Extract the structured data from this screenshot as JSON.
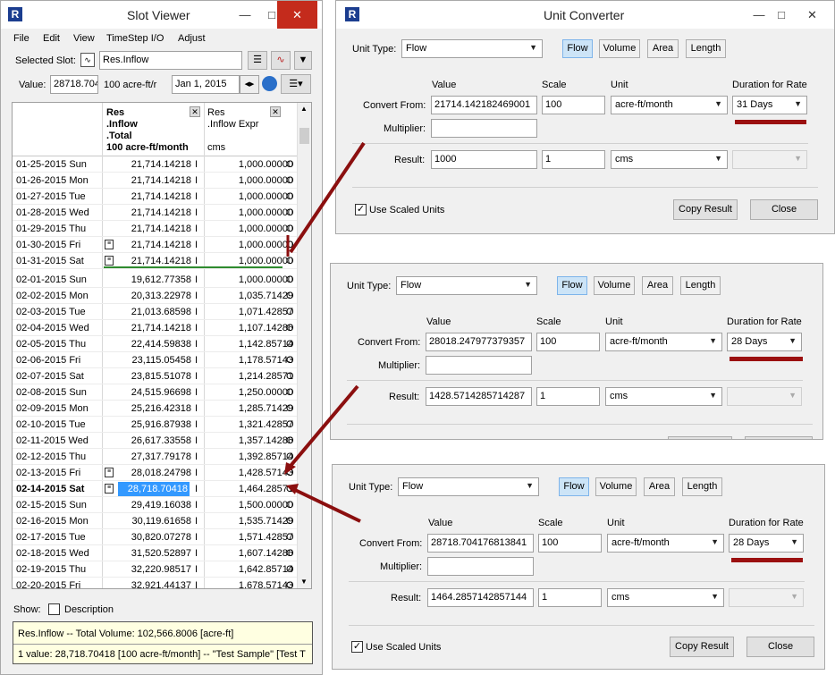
{
  "slot_viewer": {
    "title": "Slot Viewer",
    "menu": [
      "File",
      "Edit",
      "View",
      "TimeStep I/O",
      "Adjust"
    ],
    "selected_slot_label": "Selected Slot:",
    "selected_slot_value": "Res.Inflow",
    "value_label": "Value:",
    "value_field": "28718.704",
    "value_units": "100 acre-ft/r",
    "date_field": "Jan 1, 2015",
    "col1_header": [
      ".Inflow",
      ".Total",
      "100 acre-ft/month"
    ],
    "col1_header_top": "Res",
    "col2_header_top": "Res",
    "col2_header": ".Inflow Expr",
    "col2_units": "cms",
    "rows": [
      {
        "date": "01-25-2015 Sun",
        "v1": "21,714.14218",
        "f1": "I",
        "v2": "1,000.00000",
        "f2": "O",
        "note": false
      },
      {
        "date": "01-26-2015 Mon",
        "v1": "21,714.14218",
        "f1": "I",
        "v2": "1,000.00000",
        "f2": "O",
        "note": false
      },
      {
        "date": "01-27-2015 Tue",
        "v1": "21,714.14218",
        "f1": "I",
        "v2": "1,000.00000",
        "f2": "O",
        "note": false
      },
      {
        "date": "01-28-2015 Wed",
        "v1": "21,714.14218",
        "f1": "I",
        "v2": "1,000.00000",
        "f2": "O",
        "note": false
      },
      {
        "date": "01-29-2015 Thu",
        "v1": "21,714.14218",
        "f1": "I",
        "v2": "1,000.00000",
        "f2": "O",
        "note": false
      },
      {
        "date": "01-30-2015 Fri",
        "v1": "21,714.14218",
        "f1": "I",
        "v2": "1,000.00000",
        "f2": "O",
        "note": true
      },
      {
        "date": "01-31-2015 Sat",
        "v1": "21,714.14218",
        "f1": "I",
        "v2": "1,000.00000",
        "f2": "O",
        "note": true
      },
      {
        "date": "02-01-2015 Sun",
        "v1": "19,612.77358",
        "f1": "I",
        "v2": "1,000.00000",
        "f2": "O",
        "note": false
      },
      {
        "date": "02-02-2015 Mon",
        "v1": "20,313.22978",
        "f1": "I",
        "v2": "1,035.71429",
        "f2": "O",
        "note": false
      },
      {
        "date": "02-03-2015 Tue",
        "v1": "21,013.68598",
        "f1": "I",
        "v2": "1,071.42857",
        "f2": "O",
        "note": false
      },
      {
        "date": "02-04-2015 Wed",
        "v1": "21,714.14218",
        "f1": "I",
        "v2": "1,107.14286",
        "f2": "O",
        "note": false
      },
      {
        "date": "02-05-2015 Thu",
        "v1": "22,414.59838",
        "f1": "I",
        "v2": "1,142.85714",
        "f2": "O",
        "note": false
      },
      {
        "date": "02-06-2015 Fri",
        "v1": "23,115.05458",
        "f1": "I",
        "v2": "1,178.57143",
        "f2": "O",
        "note": false
      },
      {
        "date": "02-07-2015 Sat",
        "v1": "23,815.51078",
        "f1": "I",
        "v2": "1,214.28571",
        "f2": "O",
        "note": false
      },
      {
        "date": "02-08-2015 Sun",
        "v1": "24,515.96698",
        "f1": "I",
        "v2": "1,250.00000",
        "f2": "O",
        "note": false
      },
      {
        "date": "02-09-2015 Mon",
        "v1": "25,216.42318",
        "f1": "I",
        "v2": "1,285.71429",
        "f2": "O",
        "note": false
      },
      {
        "date": "02-10-2015 Tue",
        "v1": "25,916.87938",
        "f1": "I",
        "v2": "1,321.42857",
        "f2": "O",
        "note": false
      },
      {
        "date": "02-11-2015 Wed",
        "v1": "26,617.33558",
        "f1": "I",
        "v2": "1,357.14286",
        "f2": "O",
        "note": false
      },
      {
        "date": "02-12-2015 Thu",
        "v1": "27,317.79178",
        "f1": "I",
        "v2": "1,392.85714",
        "f2": "O",
        "note": false
      },
      {
        "date": "02-13-2015 Fri",
        "v1": "28,018.24798",
        "f1": "I",
        "v2": "1,428.57143",
        "f2": "O",
        "note": true
      },
      {
        "date": "02-14-2015 Sat",
        "v1": "28,718.70418",
        "f1": "I",
        "v2": "1,464.28571",
        "f2": "O",
        "note": true,
        "selected": true
      },
      {
        "date": "02-15-2015 Sun",
        "v1": "29,419.16038",
        "f1": "I",
        "v2": "1,500.00000",
        "f2": "O",
        "note": false
      },
      {
        "date": "02-16-2015 Mon",
        "v1": "30,119.61658",
        "f1": "I",
        "v2": "1,535.71429",
        "f2": "O",
        "note": false
      },
      {
        "date": "02-17-2015 Tue",
        "v1": "30,820.07278",
        "f1": "I",
        "v2": "1,571.42857",
        "f2": "O",
        "note": false
      },
      {
        "date": "02-18-2015 Wed",
        "v1": "31,520.52897",
        "f1": "I",
        "v2": "1,607.14286",
        "f2": "O",
        "note": false
      },
      {
        "date": "02-19-2015 Thu",
        "v1": "32,220.98517",
        "f1": "I",
        "v2": "1,642.85714",
        "f2": "O",
        "note": false
      },
      {
        "date": "02-20-2015 Fri",
        "v1": "32,921.44137",
        "f1": "I",
        "v2": "1,678.57143",
        "f2": "O",
        "note": false
      }
    ],
    "show_label": "Show:",
    "description_label": "Description",
    "status_line1": "Res.Inflow -- Total Volume: 102,566.8006 [acre-ft]",
    "status_line2": "1 value:  28,718.70418 [100 acre-ft/month] -- \"Test Sample\" [Test T"
  },
  "converters": [
    {
      "title": "Unit Converter",
      "unit_type_label": "Unit Type:",
      "unit_type": "Flow",
      "type_buttons": [
        "Flow",
        "Volume",
        "Area",
        "Length"
      ],
      "col_value": "Value",
      "col_scale": "Scale",
      "col_unit": "Unit",
      "col_duration": "Duration for Rate",
      "convert_from_label": "Convert From:",
      "from_value": "21714.142182469001",
      "from_scale": "100",
      "from_unit": "acre-ft/month",
      "duration": "31 Days",
      "multiplier_label": "Multiplier:",
      "result_label": "Result:",
      "result_value": "1000",
      "result_scale": "1",
      "result_unit": "cms",
      "use_scaled_units": "Use Scaled Units",
      "copy_result": "Copy Result",
      "close": "Close"
    },
    {
      "title": "",
      "unit_type_label": "Unit Type:",
      "unit_type": "Flow",
      "type_buttons": [
        "Flow",
        "Volume",
        "Area",
        "Length"
      ],
      "col_value": "Value",
      "col_scale": "Scale",
      "col_unit": "Unit",
      "col_duration": "Duration for Rate",
      "convert_from_label": "Convert From:",
      "from_value": "28018.247977379357",
      "from_scale": "100",
      "from_unit": "acre-ft/month",
      "duration": "28 Days",
      "multiplier_label": "Multiplier:",
      "result_label": "Result:",
      "result_value": "1428.5714285714287",
      "result_scale": "1",
      "result_unit": "cms"
    },
    {
      "title": "",
      "unit_type_label": "Unit Type:",
      "unit_type": "Flow",
      "type_buttons": [
        "Flow",
        "Volume",
        "Area",
        "Length"
      ],
      "col_value": "Value",
      "col_scale": "Scale",
      "col_unit": "Unit",
      "col_duration": "Duration for Rate",
      "convert_from_label": "Convert From:",
      "from_value": "28718.704176813841",
      "from_scale": "100",
      "from_unit": "acre-ft/month",
      "duration": "28 Days",
      "multiplier_label": "Multiplier:",
      "result_label": "Result:",
      "result_value": "1464.2857142857144",
      "result_scale": "1",
      "result_unit": "cms",
      "use_scaled_units": "Use Scaled Units",
      "copy_result": "Copy Result",
      "close": "Close"
    }
  ],
  "colors": {
    "annotation_arrow": "#8b0f0f",
    "month_divider": "#2e8b2e",
    "selection": "#3399ff",
    "active_type_button": "#cce4f7",
    "close_button": "#c42b1c"
  },
  "icons": [
    "app-logo-icon",
    "slot-icon",
    "list-view-icon",
    "plot-icon",
    "dropdown-icon",
    "globe-icon",
    "config-icon",
    "note-icon",
    "close-icon",
    "minimize-icon"
  ],
  "checkmark": "✓"
}
